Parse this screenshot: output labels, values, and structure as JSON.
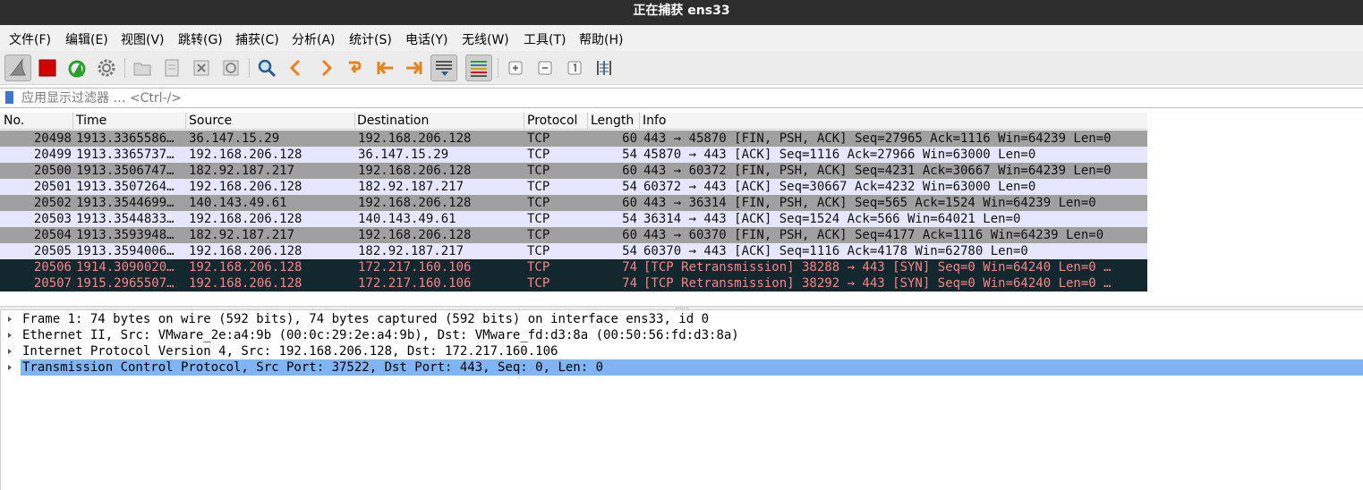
{
  "window": {
    "title": "正在捕获 ens33"
  },
  "menu": [
    {
      "label": "文件(F)"
    },
    {
      "label": "编辑(E)"
    },
    {
      "label": "视图(V)"
    },
    {
      "label": "跳转(G)"
    },
    {
      "label": "捕获(C)"
    },
    {
      "label": "分析(A)"
    },
    {
      "label": "统计(S)"
    },
    {
      "label": "电话(Y)"
    },
    {
      "label": "无线(W)"
    },
    {
      "label": "工具(T)"
    },
    {
      "label": "帮助(H)"
    }
  ],
  "toolbar": {
    "icons": [
      "shark-fin-icon",
      "stop-square-icon",
      "restart-fin-icon",
      "gear-icon",
      "open-folder-icon",
      "save-file-icon",
      "close-file-icon",
      "reload-icon",
      "search-icon",
      "prev-arrow-icon",
      "next-arrow-icon",
      "jump-arrow-icon",
      "first-packet-icon",
      "last-packet-icon",
      "autoscroll-icon",
      "colorize-icon",
      "zoom-in-icon",
      "zoom-out-icon",
      "zoom-normal-icon",
      "resize-columns-icon"
    ],
    "accent": "#3a78c7",
    "stop_color": "#d40000",
    "restart_color": "#2aa02a"
  },
  "filter": {
    "placeholder": "应用显示过滤器 … <Ctrl-/>",
    "value": ""
  },
  "packet_list": {
    "columns": [
      "No.",
      "Time",
      "Source",
      "Destination",
      "Protocol",
      "Length",
      "Info"
    ],
    "rows": [
      {
        "no": "20498",
        "time": "1913.3365586…",
        "src": "36.147.15.29",
        "dst": "192.168.206.128",
        "proto": "TCP",
        "len": "60",
        "info": "443 → 45870 [FIN, PSH, ACK] Seq=27965 Ack=1116 Win=64239 Len=0",
        "style": "fin"
      },
      {
        "no": "20499",
        "time": "1913.3365737…",
        "src": "192.168.206.128",
        "dst": "36.147.15.29",
        "proto": "TCP",
        "len": "54",
        "info": "45870 → 443 [ACK] Seq=1116 Ack=27966 Win=63000 Len=0",
        "style": "ack"
      },
      {
        "no": "20500",
        "time": "1913.3506747…",
        "src": "182.92.187.217",
        "dst": "192.168.206.128",
        "proto": "TCP",
        "len": "60",
        "info": "443 → 60372 [FIN, PSH, ACK] Seq=4231 Ack=30667 Win=64239 Len=0",
        "style": "fin"
      },
      {
        "no": "20501",
        "time": "1913.3507264…",
        "src": "192.168.206.128",
        "dst": "182.92.187.217",
        "proto": "TCP",
        "len": "54",
        "info": "60372 → 443 [ACK] Seq=30667 Ack=4232 Win=63000 Len=0",
        "style": "ack"
      },
      {
        "no": "20502",
        "time": "1913.3544699…",
        "src": "140.143.49.61",
        "dst": "192.168.206.128",
        "proto": "TCP",
        "len": "60",
        "info": "443 → 36314 [FIN, PSH, ACK] Seq=565 Ack=1524 Win=64239 Len=0",
        "style": "fin"
      },
      {
        "no": "20503",
        "time": "1913.3544833…",
        "src": "192.168.206.128",
        "dst": "140.143.49.61",
        "proto": "TCP",
        "len": "54",
        "info": "36314 → 443 [ACK] Seq=1524 Ack=566 Win=64021 Len=0",
        "style": "ack"
      },
      {
        "no": "20504",
        "time": "1913.3593948…",
        "src": "182.92.187.217",
        "dst": "192.168.206.128",
        "proto": "TCP",
        "len": "60",
        "info": "443 → 60370 [FIN, PSH, ACK] Seq=4177 Ack=1116 Win=64239 Len=0",
        "style": "fin"
      },
      {
        "no": "20505",
        "time": "1913.3594006…",
        "src": "192.168.206.128",
        "dst": "182.92.187.217",
        "proto": "TCP",
        "len": "54",
        "info": "60370 → 443 [ACK] Seq=1116 Ack=4178 Win=62780 Len=0",
        "style": "ack"
      },
      {
        "no": "20506",
        "time": "1914.3090020…",
        "src": "192.168.206.128",
        "dst": "172.217.160.106",
        "proto": "TCP",
        "len": "74",
        "info": "[TCP Retransmission] 38288 → 443 [SYN] Seq=0 Win=64240 Len=0 …",
        "style": "ret"
      },
      {
        "no": "20507",
        "time": "1915.2965507…",
        "src": "192.168.206.128",
        "dst": "172.217.160.106",
        "proto": "TCP",
        "len": "74",
        "info": "[TCP Retransmission] 38292 → 443 [SYN] Seq=0 Win=64240 Len=0 …",
        "style": "ret"
      }
    ],
    "colors": {
      "fin_bg": "#a0a0a0",
      "ack_bg": "#e7e6ff",
      "ret_bg": "#12272e",
      "ret_fg": "#f78787"
    }
  },
  "details": {
    "items": [
      {
        "text": "Frame 1: 74 bytes on wire (592 bits), 74 bytes captured (592 bits) on interface ens33, id 0",
        "selected": false
      },
      {
        "text": "Ethernet II, Src: VMware_2e:a4:9b (00:0c:29:2e:a4:9b), Dst: VMware_fd:d3:8a (00:50:56:fd:d3:8a)",
        "selected": false
      },
      {
        "text": "Internet Protocol Version 4, Src: 192.168.206.128, Dst: 172.217.160.106",
        "selected": false
      },
      {
        "text": "Transmission Control Protocol, Src Port: 37522, Dst Port: 443, Seq: 0, Len: 0",
        "selected": true
      }
    ],
    "selected_color": "#7fb4f5"
  }
}
